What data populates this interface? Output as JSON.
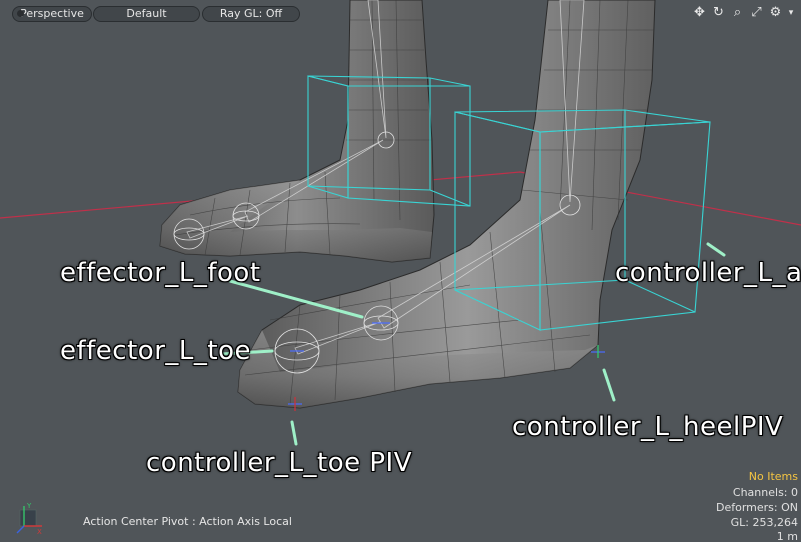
{
  "toolbar": {
    "view_mode": "Perspective",
    "shading": "Default",
    "raygl": "Ray GL: Off"
  },
  "nav_icons": [
    "move-view-icon",
    "rotate-view-icon",
    "zoom-view-icon",
    "fit-view-icon",
    "view-options-gear-icon"
  ],
  "labels": {
    "effector_foot": "effector_L_foot",
    "effector_toe": "effector_L_toe",
    "controller_toe_piv": "controller_L_toe PIV",
    "controller_ankle": "controller_L_ankle",
    "controller_heel_piv": "controller_L_heelPIV"
  },
  "status": {
    "no_items": "No Items",
    "channels": "Channels: 0",
    "deformers": "Deformers: ON",
    "gl": "GL: 253,264",
    "unit": "1 m"
  },
  "action_center": "Action Center Pivot : Action Axis Local",
  "axis_gizmo": {
    "y_label": "Y",
    "x_label": "X"
  },
  "colors": {
    "viewport_bg": "#505559",
    "controller_box": "#39d4d4",
    "callout_line": "#9ff0c8",
    "horizon_line": "#c0304a",
    "status_highlight": "#f5c542"
  }
}
